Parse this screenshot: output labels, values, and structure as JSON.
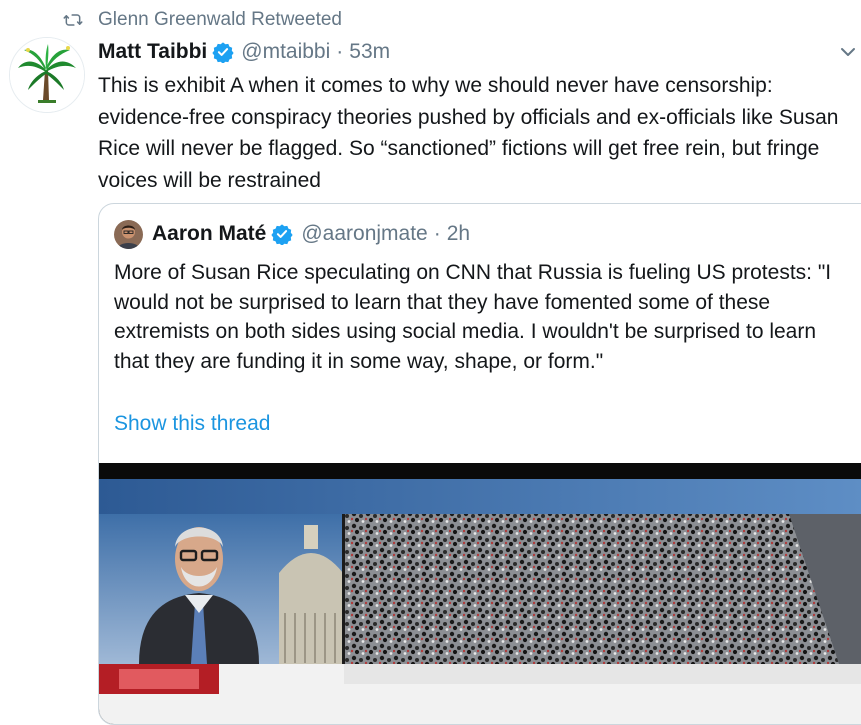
{
  "retweet": {
    "text": "Glenn Greenwald Retweeted",
    "icon": "retweet-icon"
  },
  "tweet": {
    "author_name": "Matt Taibbi",
    "handle": "@mtaibbi",
    "separator": "·",
    "time": "53m",
    "text": "This is exhibit A when it comes to why we should never have censorship: evidence-free conspiracy theories pushed by officials and ex-officials like Susan Rice will never be flagged. So “sanctioned” fictions will get free rein, but fringe voices will be restrained",
    "avatar_icon": "palm-tree-avatar",
    "verified_icon": "verified-badge-icon",
    "menu_icon": "chevron-down-icon"
  },
  "quoted_tweet": {
    "author_name": "Aaron Maté",
    "handle": "@aaronjmate",
    "separator": "·",
    "time": "2h",
    "text": "More of Susan Rice speculating on CNN that Russia is fueling US protests: \"I would not be surprised to learn that they have fomented some of these extremists on both sides using social media. I wouldn't be surprised to learn that they are funding it in some way, shape, or form.\"",
    "show_thread": "Show this thread"
  },
  "colors": {
    "link": "#1b95e0",
    "secondary_text": "#657786",
    "verified": "#1da1f2",
    "border": "#ccd6dd"
  }
}
